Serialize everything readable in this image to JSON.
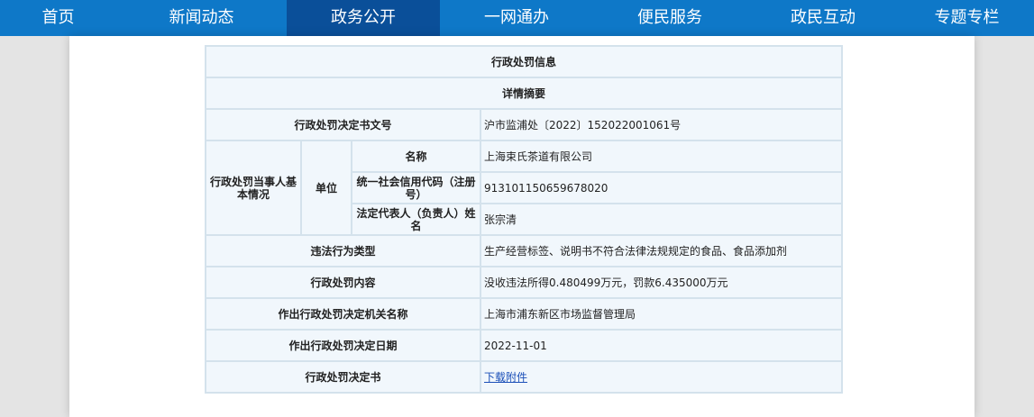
{
  "nav": {
    "items": [
      {
        "label": "首页",
        "active": false
      },
      {
        "label": "新闻动态",
        "active": false
      },
      {
        "label": "政务公开",
        "active": true
      },
      {
        "label": "一网通办",
        "active": false
      },
      {
        "label": "便民服务",
        "active": false
      },
      {
        "label": "政民互动",
        "active": false
      },
      {
        "label": "专题专栏",
        "active": false
      }
    ]
  },
  "table": {
    "title": "行政处罚信息",
    "summary": "详情摘要",
    "doc_no": {
      "label": "行政处罚决定书文号",
      "value": "沪市监浦处〔2022〕152022001061号"
    },
    "party": {
      "group_label": "行政处罚当事人基本情况",
      "unit_label": "单位",
      "name": {
        "label": "名称",
        "value": "上海束氏茶道有限公司"
      },
      "credit_code": {
        "label": "统一社会信用代码（注册号）",
        "value": "913101150659678020"
      },
      "legal_rep": {
        "label": "法定代表人（负责人）姓名",
        "value": "张宗清"
      }
    },
    "violation_type": {
      "label": "违法行为类型",
      "value": "生产经营标签、说明书不符合法律法规规定的食品、食品添加剂"
    },
    "penalty_content": {
      "label": "行政处罚内容",
      "value": "没收违法所得0.480499万元，罚款6.435000万元"
    },
    "authority": {
      "label": "作出行政处罚决定机关名称",
      "value": "上海市浦东新区市场监督管理局"
    },
    "decision_date": {
      "label": "作出行政处罚决定日期",
      "value": "2022-11-01"
    },
    "decision_doc": {
      "label": "行政处罚决定书",
      "link_text": "下载附件"
    }
  }
}
